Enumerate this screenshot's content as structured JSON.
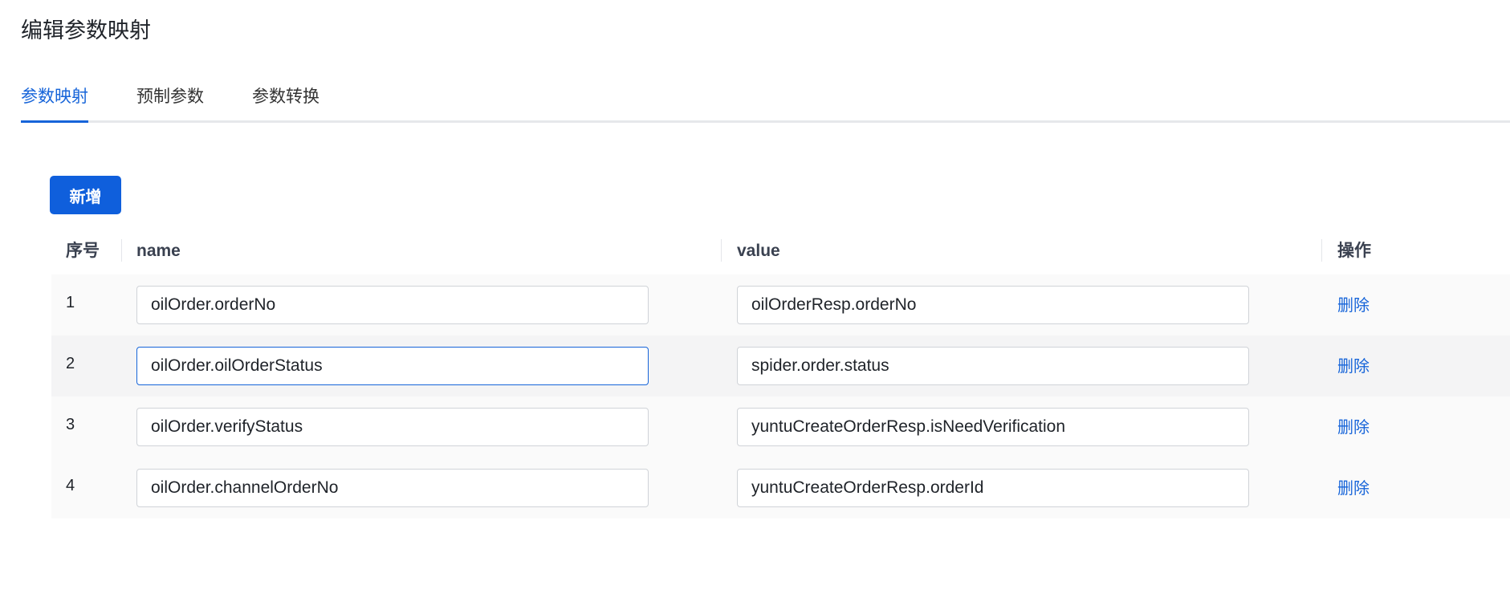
{
  "page": {
    "title": "编辑参数映射"
  },
  "tabs": [
    {
      "label": "参数映射",
      "active": true
    },
    {
      "label": "预制参数",
      "active": false
    },
    {
      "label": "参数转换",
      "active": false
    }
  ],
  "toolbar": {
    "add_label": "新增"
  },
  "table": {
    "headers": {
      "index": "序号",
      "name": "name",
      "value": "value",
      "action": "操作"
    },
    "rows": [
      {
        "index": "1",
        "name": "oilOrder.orderNo",
        "value": "oilOrderResp.orderNo",
        "action": "删除"
      },
      {
        "index": "2",
        "name": "oilOrder.oilOrderStatus",
        "value": "spider.order.status",
        "action": "删除"
      },
      {
        "index": "3",
        "name": "oilOrder.verifyStatus",
        "value": "yuntuCreateOrderResp.isNeedVerification",
        "action": "删除"
      },
      {
        "index": "4",
        "name": "oilOrder.channelOrderNo",
        "value": "yuntuCreateOrderResp.orderId",
        "action": "删除"
      }
    ]
  },
  "colors": {
    "accent": "#1664d9",
    "primary_button": "#0f5fdc"
  }
}
